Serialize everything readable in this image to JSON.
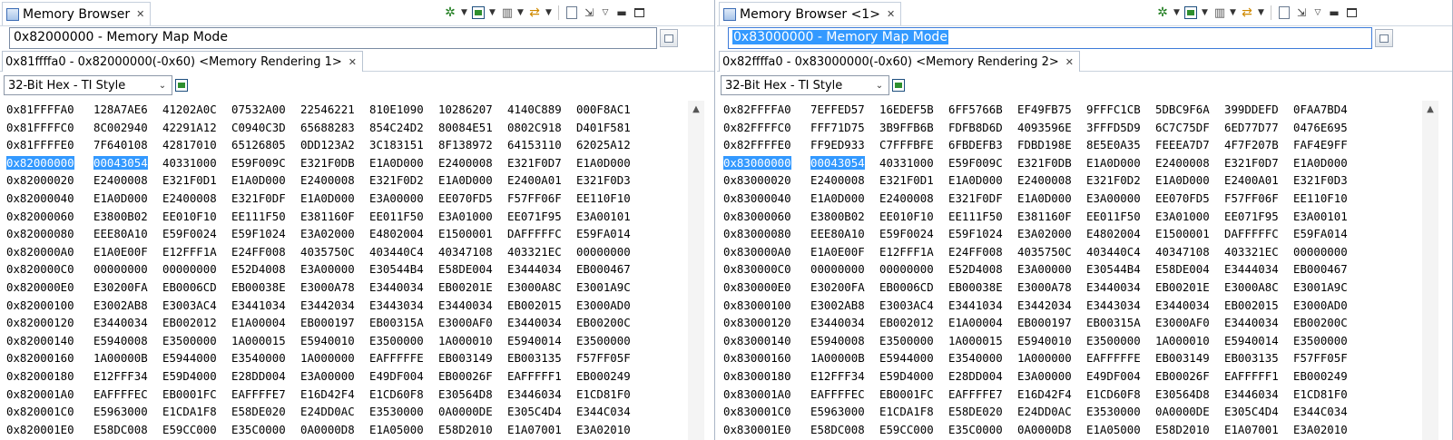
{
  "panes": [
    {
      "view_tab": {
        "title": "Memory Browser",
        "close": "✕"
      },
      "address_input": {
        "value": "0x82000000 - Memory Map Mode"
      },
      "rendering_tab": {
        "label": "0x81ffffa0 - 0x82000000(-0x60) <Memory Rendering 1>",
        "close": "✕"
      },
      "format_select": {
        "value": "32-Bit Hex - TI Style"
      },
      "highlight_row_index": 3,
      "rows": [
        {
          "addr": "0x81FFFFA0",
          "cells": [
            "128A7AE6",
            "41202A0C",
            "07532A00",
            "22546221",
            "810E1090",
            "10286207",
            "4140C889",
            "000F8AC1"
          ]
        },
        {
          "addr": "0x81FFFFC0",
          "cells": [
            "8C002940",
            "42291A12",
            "C0940C3D",
            "65688283",
            "854C24D2",
            "80084E51",
            "0802C918",
            "D401F581"
          ]
        },
        {
          "addr": "0x81FFFFE0",
          "cells": [
            "7F640108",
            "42817010",
            "65126805",
            "0DD123A2",
            "3C183151",
            "8F138972",
            "64153110",
            "62025A12"
          ]
        },
        {
          "addr": "0x82000000",
          "cells": [
            "00043054",
            "40331000",
            "E59F009C",
            "E321F0DB",
            "E1A0D000",
            "E2400008",
            "E321F0D7",
            "E1A0D000"
          ]
        },
        {
          "addr": "0x82000020",
          "cells": [
            "E2400008",
            "E321F0D1",
            "E1A0D000",
            "E2400008",
            "E321F0D2",
            "E1A0D000",
            "E2400A01",
            "E321F0D3"
          ]
        },
        {
          "addr": "0x82000040",
          "cells": [
            "E1A0D000",
            "E2400008",
            "E321F0DF",
            "E1A0D000",
            "E3A00000",
            "EE070FD5",
            "F57FF06F",
            "EE110F10"
          ]
        },
        {
          "addr": "0x82000060",
          "cells": [
            "E3800B02",
            "EE010F10",
            "EE111F50",
            "E381160F",
            "EE011F50",
            "E3A01000",
            "EE071F95",
            "E3A00101"
          ]
        },
        {
          "addr": "0x82000080",
          "cells": [
            "EEE80A10",
            "E59F0024",
            "E59F1024",
            "E3A02000",
            "E4802004",
            "E1500001",
            "DAFFFFFC",
            "E59FA014"
          ]
        },
        {
          "addr": "0x820000A0",
          "cells": [
            "E1A0E00F",
            "E12FFF1A",
            "E24FF008",
            "4035750C",
            "403440C4",
            "40347108",
            "403321EC",
            "00000000"
          ]
        },
        {
          "addr": "0x820000C0",
          "cells": [
            "00000000",
            "00000000",
            "E52D4008",
            "E3A00000",
            "E30544B4",
            "E58DE004",
            "E3444034",
            "EB000467"
          ]
        },
        {
          "addr": "0x820000E0",
          "cells": [
            "E30200FA",
            "EB0006CD",
            "EB00038E",
            "E3000A78",
            "E3440034",
            "EB00201E",
            "E3000A8C",
            "E3001A9C"
          ]
        },
        {
          "addr": "0x82000100",
          "cells": [
            "E3002AB8",
            "E3003AC4",
            "E3441034",
            "E3442034",
            "E3443034",
            "E3440034",
            "EB002015",
            "E3000AD0"
          ]
        },
        {
          "addr": "0x82000120",
          "cells": [
            "E3440034",
            "EB002012",
            "E1A00004",
            "EB000197",
            "EB00315A",
            "E3000AF0",
            "E3440034",
            "EB00200C"
          ]
        },
        {
          "addr": "0x82000140",
          "cells": [
            "E5940008",
            "E3500000",
            "1A000015",
            "E5940010",
            "E3500000",
            "1A000010",
            "E5940014",
            "E3500000"
          ]
        },
        {
          "addr": "0x82000160",
          "cells": [
            "1A00000B",
            "E5944000",
            "E3540000",
            "1A000000",
            "EAFFFFFE",
            "EB003149",
            "EB003135",
            "F57FF05F"
          ]
        },
        {
          "addr": "0x82000180",
          "cells": [
            "E12FFF34",
            "E59D4000",
            "E28DD004",
            "E3A00000",
            "E49DF004",
            "EB00026F",
            "EAFFFFF1",
            "EB000249"
          ]
        },
        {
          "addr": "0x820001A0",
          "cells": [
            "EAFFFFEC",
            "EB0001FC",
            "EAFFFFE7",
            "E16D42F4",
            "E1CD60F8",
            "E30564D8",
            "E3446034",
            "E1CD81F0"
          ]
        },
        {
          "addr": "0x820001C0",
          "cells": [
            "E5963000",
            "E1CDA1F8",
            "E58DE020",
            "E24DD0AC",
            "E3530000",
            "0A0000DE",
            "E305C4D4",
            "E344C034"
          ]
        },
        {
          "addr": "0x820001E0",
          "cells": [
            "E58DC008",
            "E59CC000",
            "E35C0000",
            "0A0000D8",
            "E1A05000",
            "E58D2010",
            "E1A07001",
            "E3A02010"
          ]
        }
      ]
    },
    {
      "view_tab": {
        "title": "Memory Browser <1>",
        "close": "✕"
      },
      "address_input": {
        "value": "0x83000000 - Memory Map Mode"
      },
      "rendering_tab": {
        "label": "0x82ffffa0 - 0x83000000(-0x60) <Memory Rendering 2>",
        "close": "✕"
      },
      "format_select": {
        "value": "32-Bit Hex - TI Style"
      },
      "highlight_row_index": 3,
      "rows": [
        {
          "addr": "0x82FFFFA0",
          "cells": [
            "7EFFED57",
            "16EDEF5B",
            "6FF5766B",
            "EF49FB75",
            "9FFFC1CB",
            "5DBC9F6A",
            "399DDEFD",
            "0FAA7BD4"
          ]
        },
        {
          "addr": "0x82FFFFC0",
          "cells": [
            "FFF71D75",
            "3B9FFB6B",
            "FDFB8D6D",
            "4093596E",
            "3FFFD5D9",
            "6C7C75DF",
            "6ED77D77",
            "0476E695"
          ]
        },
        {
          "addr": "0x82FFFFE0",
          "cells": [
            "FF9ED933",
            "C7FFFBFE",
            "6FBDEFB3",
            "FDBD198E",
            "8E5E0A35",
            "FEEEA7D7",
            "4F7F207B",
            "FAF4E9FF"
          ]
        },
        {
          "addr": "0x83000000",
          "cells": [
            "00043054",
            "40331000",
            "E59F009C",
            "E321F0DB",
            "E1A0D000",
            "E2400008",
            "E321F0D7",
            "E1A0D000"
          ]
        },
        {
          "addr": "0x83000020",
          "cells": [
            "E2400008",
            "E321F0D1",
            "E1A0D000",
            "E2400008",
            "E321F0D2",
            "E1A0D000",
            "E2400A01",
            "E321F0D3"
          ]
        },
        {
          "addr": "0x83000040",
          "cells": [
            "E1A0D000",
            "E2400008",
            "E321F0DF",
            "E1A0D000",
            "E3A00000",
            "EE070FD5",
            "F57FF06F",
            "EE110F10"
          ]
        },
        {
          "addr": "0x83000060",
          "cells": [
            "E3800B02",
            "EE010F10",
            "EE111F50",
            "E381160F",
            "EE011F50",
            "E3A01000",
            "EE071F95",
            "E3A00101"
          ]
        },
        {
          "addr": "0x83000080",
          "cells": [
            "EEE80A10",
            "E59F0024",
            "E59F1024",
            "E3A02000",
            "E4802004",
            "E1500001",
            "DAFFFFFC",
            "E59FA014"
          ]
        },
        {
          "addr": "0x830000A0",
          "cells": [
            "E1A0E00F",
            "E12FFF1A",
            "E24FF008",
            "4035750C",
            "403440C4",
            "40347108",
            "403321EC",
            "00000000"
          ]
        },
        {
          "addr": "0x830000C0",
          "cells": [
            "00000000",
            "00000000",
            "E52D4008",
            "E3A00000",
            "E30544B4",
            "E58DE004",
            "E3444034",
            "EB000467"
          ]
        },
        {
          "addr": "0x830000E0",
          "cells": [
            "E30200FA",
            "EB0006CD",
            "EB00038E",
            "E3000A78",
            "E3440034",
            "EB00201E",
            "E3000A8C",
            "E3001A9C"
          ]
        },
        {
          "addr": "0x83000100",
          "cells": [
            "E3002AB8",
            "E3003AC4",
            "E3441034",
            "E3442034",
            "E3443034",
            "E3440034",
            "EB002015",
            "E3000AD0"
          ]
        },
        {
          "addr": "0x83000120",
          "cells": [
            "E3440034",
            "EB002012",
            "E1A00004",
            "EB000197",
            "EB00315A",
            "E3000AF0",
            "E3440034",
            "EB00200C"
          ]
        },
        {
          "addr": "0x83000140",
          "cells": [
            "E5940008",
            "E3500000",
            "1A000015",
            "E5940010",
            "E3500000",
            "1A000010",
            "E5940014",
            "E3500000"
          ]
        },
        {
          "addr": "0x83000160",
          "cells": [
            "1A00000B",
            "E5944000",
            "E3540000",
            "1A000000",
            "EAFFFFFE",
            "EB003149",
            "EB003135",
            "F57FF05F"
          ]
        },
        {
          "addr": "0x83000180",
          "cells": [
            "E12FFF34",
            "E59D4000",
            "E28DD004",
            "E3A00000",
            "E49DF004",
            "EB00026F",
            "EAFFFFF1",
            "EB000249"
          ]
        },
        {
          "addr": "0x830001A0",
          "cells": [
            "EAFFFFEC",
            "EB0001FC",
            "EAFFFFE7",
            "E16D42F4",
            "E1CD60F8",
            "E30564D8",
            "E3446034",
            "E1CD81F0"
          ]
        },
        {
          "addr": "0x830001C0",
          "cells": [
            "E5963000",
            "E1CDA1F8",
            "E58DE020",
            "E24DD0AC",
            "E3530000",
            "0A0000DE",
            "E305C4D4",
            "E344C034"
          ]
        },
        {
          "addr": "0x830001E0",
          "cells": [
            "E58DC008",
            "E59CC000",
            "E35C0000",
            "0A0000D8",
            "E1A05000",
            "E58D2010",
            "E1A07001",
            "E3A02010"
          ]
        }
      ]
    }
  ],
  "icons": {
    "toolbar": [
      "gear-icon",
      "chevron-down-icon",
      "new-rendering-icon",
      "chevron-down-icon",
      "stack-icon",
      "chevron-down-icon",
      "sync-icon",
      "chevron-down-icon",
      "new-view-icon",
      "pin-icon",
      "view-menu-icon",
      "minimize-icon",
      "maximize-icon"
    ],
    "scroll_up": "▲"
  },
  "colors": {
    "selection": "#3399ff",
    "selection_text": "#ffffff"
  }
}
